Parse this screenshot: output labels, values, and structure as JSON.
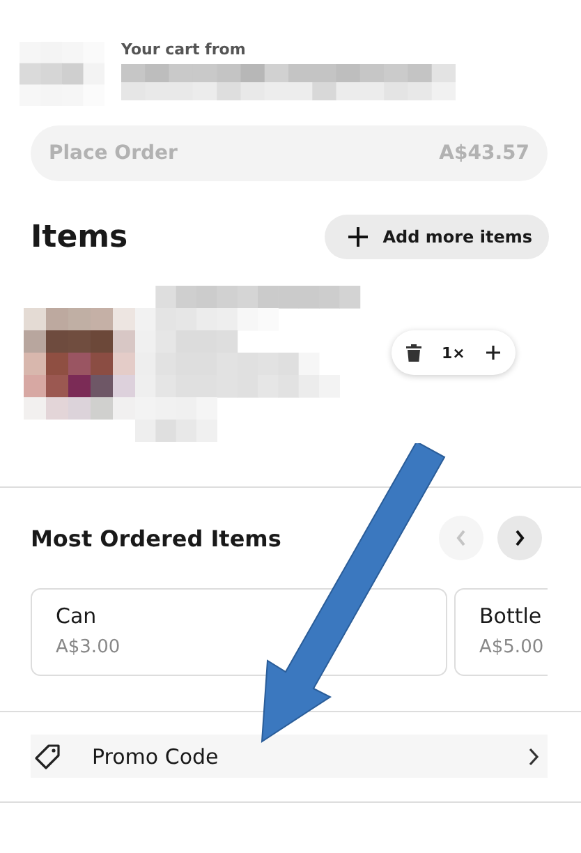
{
  "header": {
    "caption": "Your cart from"
  },
  "place_order": {
    "label": "Place Order",
    "total": "A$43.57",
    "disabled": true
  },
  "items_section": {
    "title": "Items",
    "add_button": "Add more items"
  },
  "cart_items": [
    {
      "quantity": "1×"
    }
  ],
  "most_ordered": {
    "title": "Most Ordered Items",
    "prev_disabled": true,
    "next_disabled": false,
    "products": [
      {
        "name": "Can",
        "price": "A$3.00"
      },
      {
        "name": "Bottle",
        "price": "A$5.00"
      }
    ]
  },
  "promo": {
    "label": "Promo Code"
  }
}
